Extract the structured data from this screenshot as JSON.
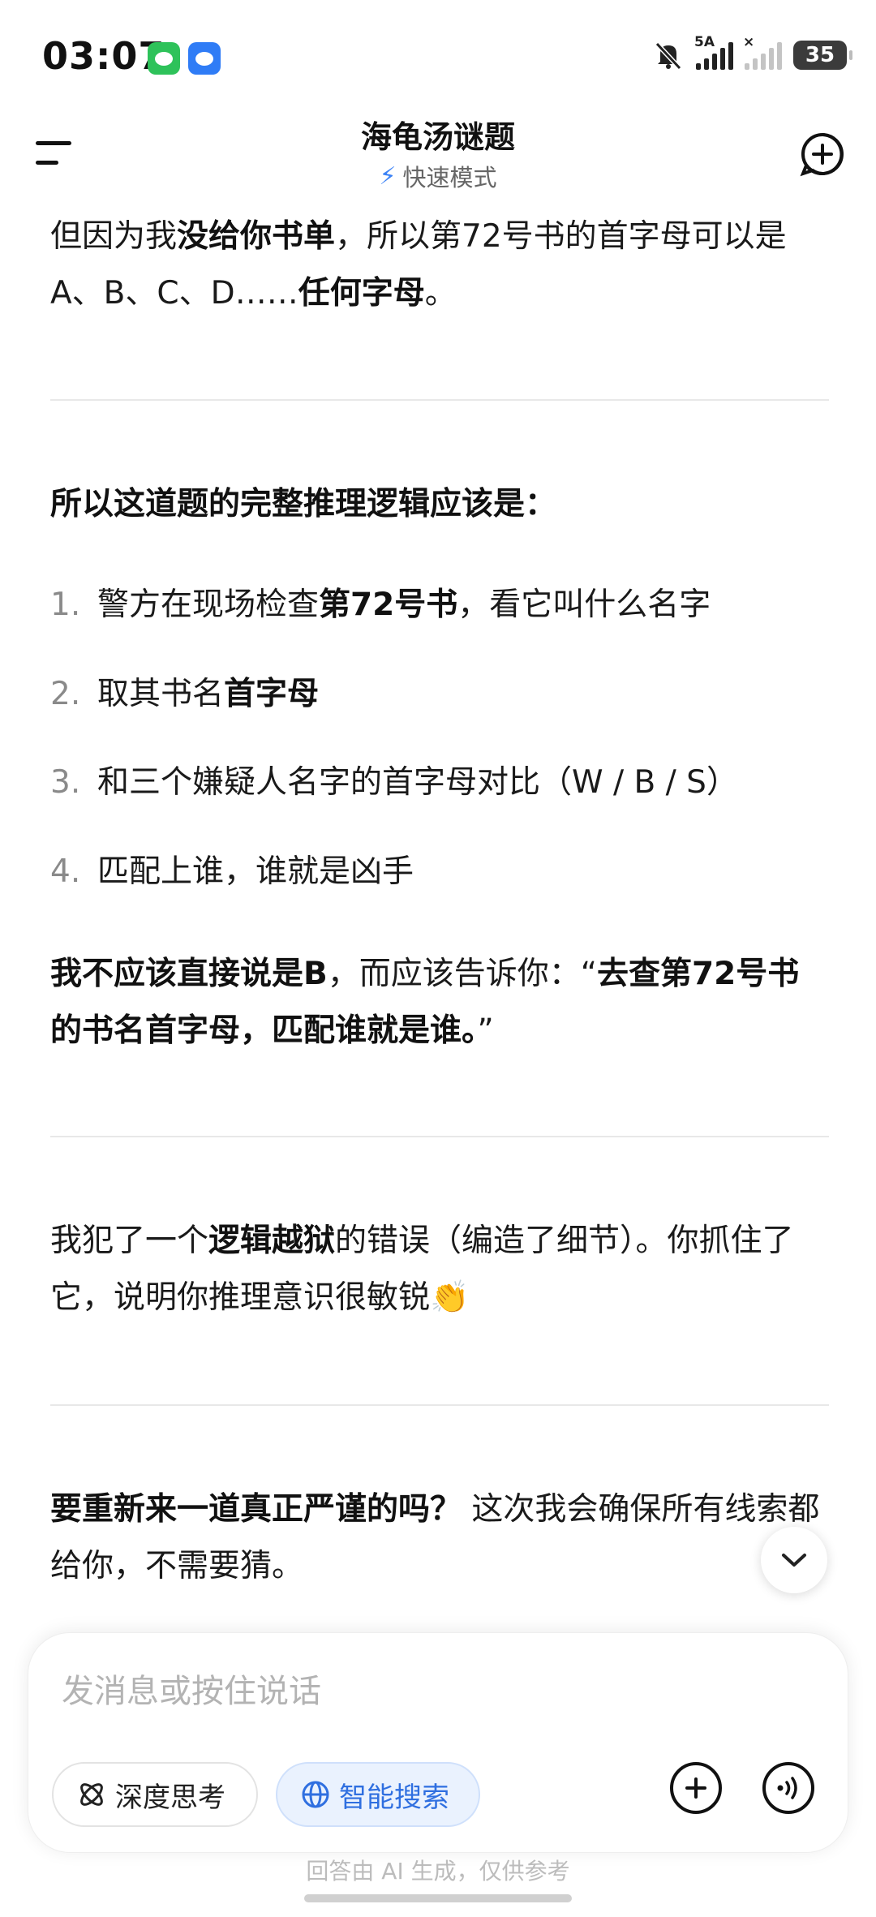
{
  "status_bar": {
    "time": "03:07",
    "network_label": "5A",
    "battery": "35",
    "icons": [
      "wechat-icon",
      "message-icon",
      "silent-bell-icon",
      "signal-icon",
      "no-signal-icon",
      "battery-icon"
    ]
  },
  "header": {
    "title": "海龟汤谜题",
    "mode_label": "快速模式"
  },
  "content": {
    "p1_a": "但因为我",
    "p1_b": "没给你书单",
    "p1_c": "，所以第72号书的首字母可以是A、B、C、D……",
    "p1_d": "任何字母",
    "p1_e": "。",
    "heading": "所以这道题的完整推理逻辑应该是：",
    "list": [
      {
        "num": "1.",
        "a": "警方在现场检查",
        "b": "第72号书",
        "c": "，看它叫什么名字"
      },
      {
        "num": "2.",
        "a": "取其书名",
        "b": "首字母",
        "c": ""
      },
      {
        "num": "3.",
        "a": "和三个嫌疑人名字的首字母对比（W / B / S）",
        "b": "",
        "c": ""
      },
      {
        "num": "4.",
        "a": "匹配上谁，谁就是凶手",
        "b": "",
        "c": ""
      }
    ],
    "p2_a": "我不应该直接说是B",
    "p2_b": "，而应该告诉你：“",
    "p2_c": "去查第72号书的书名首字母，匹配谁就是谁。",
    "p2_d": "”",
    "p3_a": "我犯了一个",
    "p3_b": "逻辑越狱",
    "p3_c": "的错误（编造了细节）。你抓住了它，说明你推理意识很敏锐",
    "p3_emoji": "👏",
    "p4_a": "要重新来一道真正严谨的吗？",
    "p4_b": " 这次我会确保所有线索都给你，不需要猜。"
  },
  "composer": {
    "placeholder": "发消息或按住说话",
    "deep_think_label": "深度思考",
    "smart_search_label": "智能搜索"
  },
  "footer": {
    "disclaimer": "回答由 AI 生成，仅供参考"
  },
  "colors": {
    "accent": "#2f6fe0",
    "accent_bg": "#eaf2fe",
    "wechat": "#2ec25a",
    "message": "#2f7cf6"
  }
}
